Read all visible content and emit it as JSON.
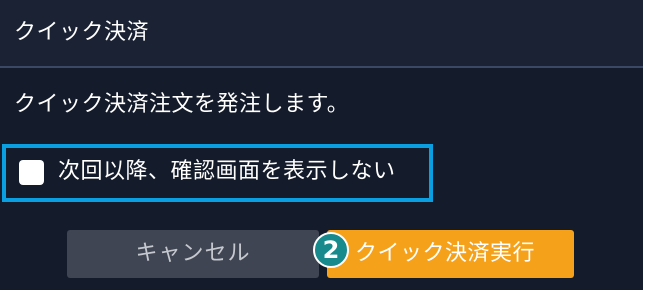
{
  "dialog": {
    "title": "クイック決済",
    "message": "クイック決済注文を発注します。",
    "checkbox": {
      "label": "次回以降、確認画面を表示しない",
      "checked": false
    },
    "buttons": {
      "cancel_label": "キャンセル",
      "execute_label": "クイック決済実行"
    },
    "step_badge": "2"
  },
  "colors": {
    "dialog_bg": "#141b2b",
    "header_bg": "#1a2233",
    "highlight_border": "#0a9fe0",
    "execute_button": "#f5a11a",
    "cancel_button": "#3f4553",
    "badge": "#168a8c"
  }
}
